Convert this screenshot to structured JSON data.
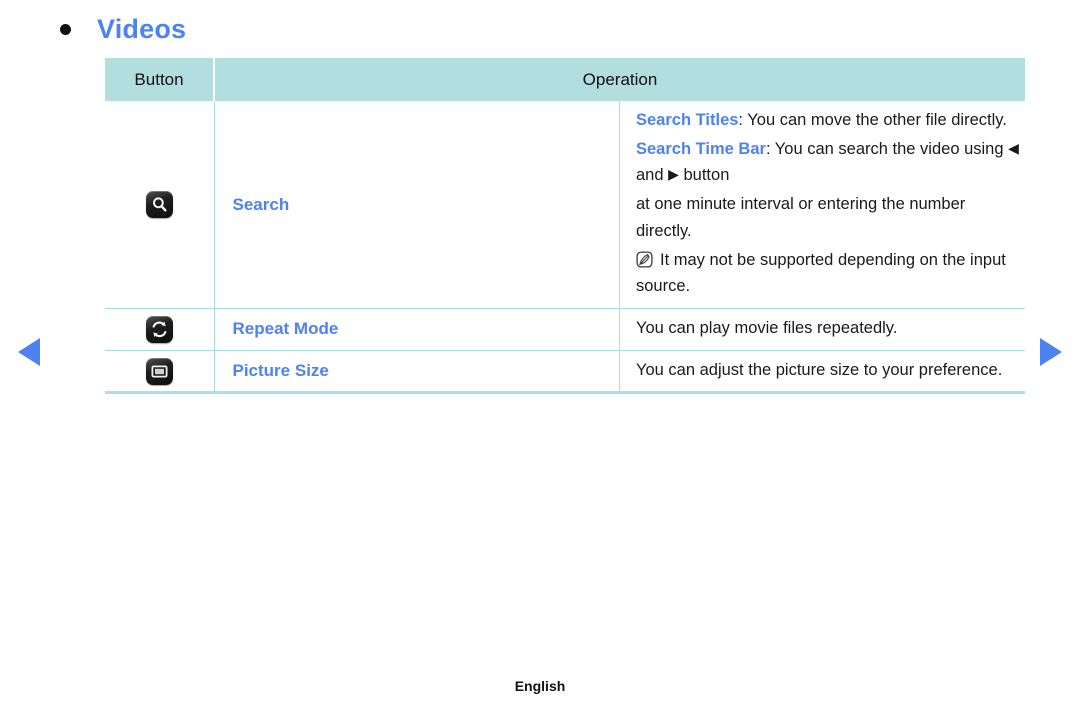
{
  "page": {
    "title": "Videos",
    "bullet_color": "#111111",
    "title_color": "#4d82f3",
    "footer_language": "English"
  },
  "table": {
    "header": {
      "button": "Button",
      "operation": "Operation"
    },
    "header_bg": "#b2dee0",
    "border_color": "#a8dcde",
    "rows": [
      {
        "icon": "search-icon",
        "name": "Search",
        "lines": [
          {
            "lead": "Search Titles",
            "rest": ": You can move the other file directly."
          },
          {
            "lead": "Search Time Bar",
            "rest": ": You can search the video using ",
            "rest2": " and ",
            "rest3": " button",
            "cont": "at one minute interval or entering the number directly."
          }
        ],
        "note": "It may not be supported depending on the input source.",
        "note_icon": "note-icon",
        "glyph_left": "◀",
        "glyph_right": "▶"
      },
      {
        "icon": "repeat-icon",
        "name": "Repeat Mode",
        "description": "You can play movie files repeatedly."
      },
      {
        "icon": "picture-size-icon",
        "name": "Picture Size",
        "description": "You can adjust the picture size to your preference."
      }
    ]
  },
  "nav": {
    "prev": "previous-page",
    "next": "next-page"
  }
}
